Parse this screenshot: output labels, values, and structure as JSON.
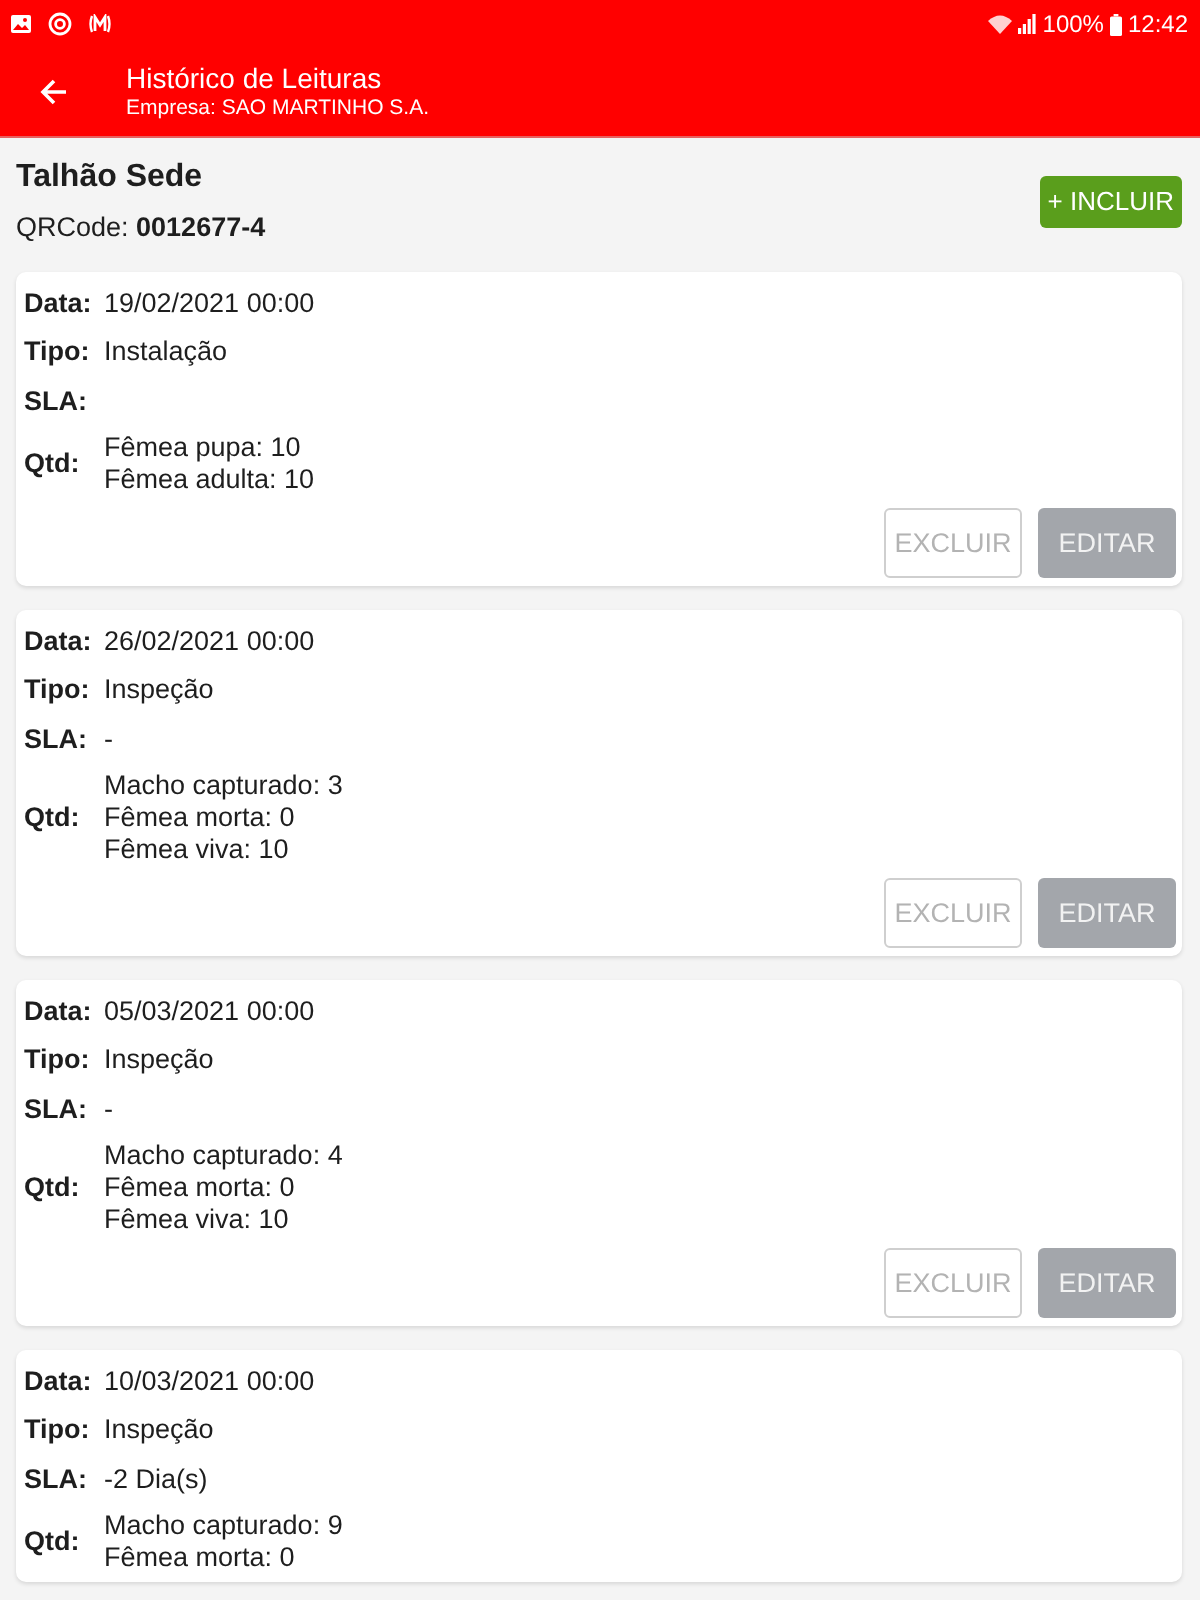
{
  "status_bar": {
    "battery": "100%",
    "time": "12:42"
  },
  "app_bar": {
    "title": "Histórico de Leituras",
    "subtitle": "Empresa: SAO MARTINHO S.A."
  },
  "header": {
    "title": "Talhão Sede",
    "qrcode": "QRCode: **0012677-4**",
    "add_button": "+ INCLUIR"
  },
  "readings": [
    {
      "data": {
        "label": "Data:",
        "value": "19/02/2021 00:00"
      },
      "tipo": {
        "label": "Tipo:",
        "value": "Instalação"
      },
      "sla": {
        "label": "SLA:"
      },
      "qtd": {
        "label": "Qtd:",
        "lines": [
          "Fêmea pupa: 10",
          "Fêmea adulta: 10"
        ]
      },
      "buttons": [
        {
          "label": "EXCLUIR",
          "kind": "outline",
          "disabled": true
        },
        {
          "label": "EDITAR",
          "kind": "filled",
          "disabled": true
        }
      ]
    },
    {
      "data": {
        "label": "Data:",
        "value": "26/02/2021 00:00"
      },
      "tipo": {
        "label": "Tipo:",
        "value": "Inspeção"
      },
      "sla": {
        "label": "SLA:",
        "value": "-"
      },
      "qtd": {
        "label": "Qtd:",
        "lines": [
          "Macho capturado: 3",
          "Fêmea morta: 0",
          "Fêmea viva: 10"
        ]
      },
      "buttons": [
        {
          "label": "EXCLUIR",
          "kind": "outline",
          "disabled": true
        },
        {
          "label": "EDITAR",
          "kind": "filled",
          "disabled": true
        }
      ]
    },
    {
      "data": {
        "label": "Data:",
        "value": "05/03/2021 00:00"
      },
      "tipo": {
        "label": "Tipo:",
        "value": "Inspeção"
      },
      "sla": {
        "label": "SLA:",
        "value": "-"
      },
      "qtd": {
        "label": "Qtd:",
        "lines": [
          "Macho capturado: 4",
          "Fêmea morta: 0",
          "Fêmea viva: 10"
        ]
      },
      "buttons": [
        {
          "label": "EXCLUIR",
          "kind": "outline",
          "disabled": true
        },
        {
          "label": "EDITAR",
          "kind": "filled",
          "disabled": true
        }
      ]
    },
    {
      "data": {
        "label": "Data:",
        "value": "10/03/2021 00:00"
      },
      "tipo": {
        "label": "Tipo:",
        "value": "Inspeção"
      },
      "sla": {
        "label": "SLA:",
        "value": "-2 Dia(s)"
      },
      "qtd": {
        "label": "Qtd:",
        "lines": [
          "Macho capturado: 9",
          "Fêmea morta: 0"
        ]
      }
    }
  ]
}
